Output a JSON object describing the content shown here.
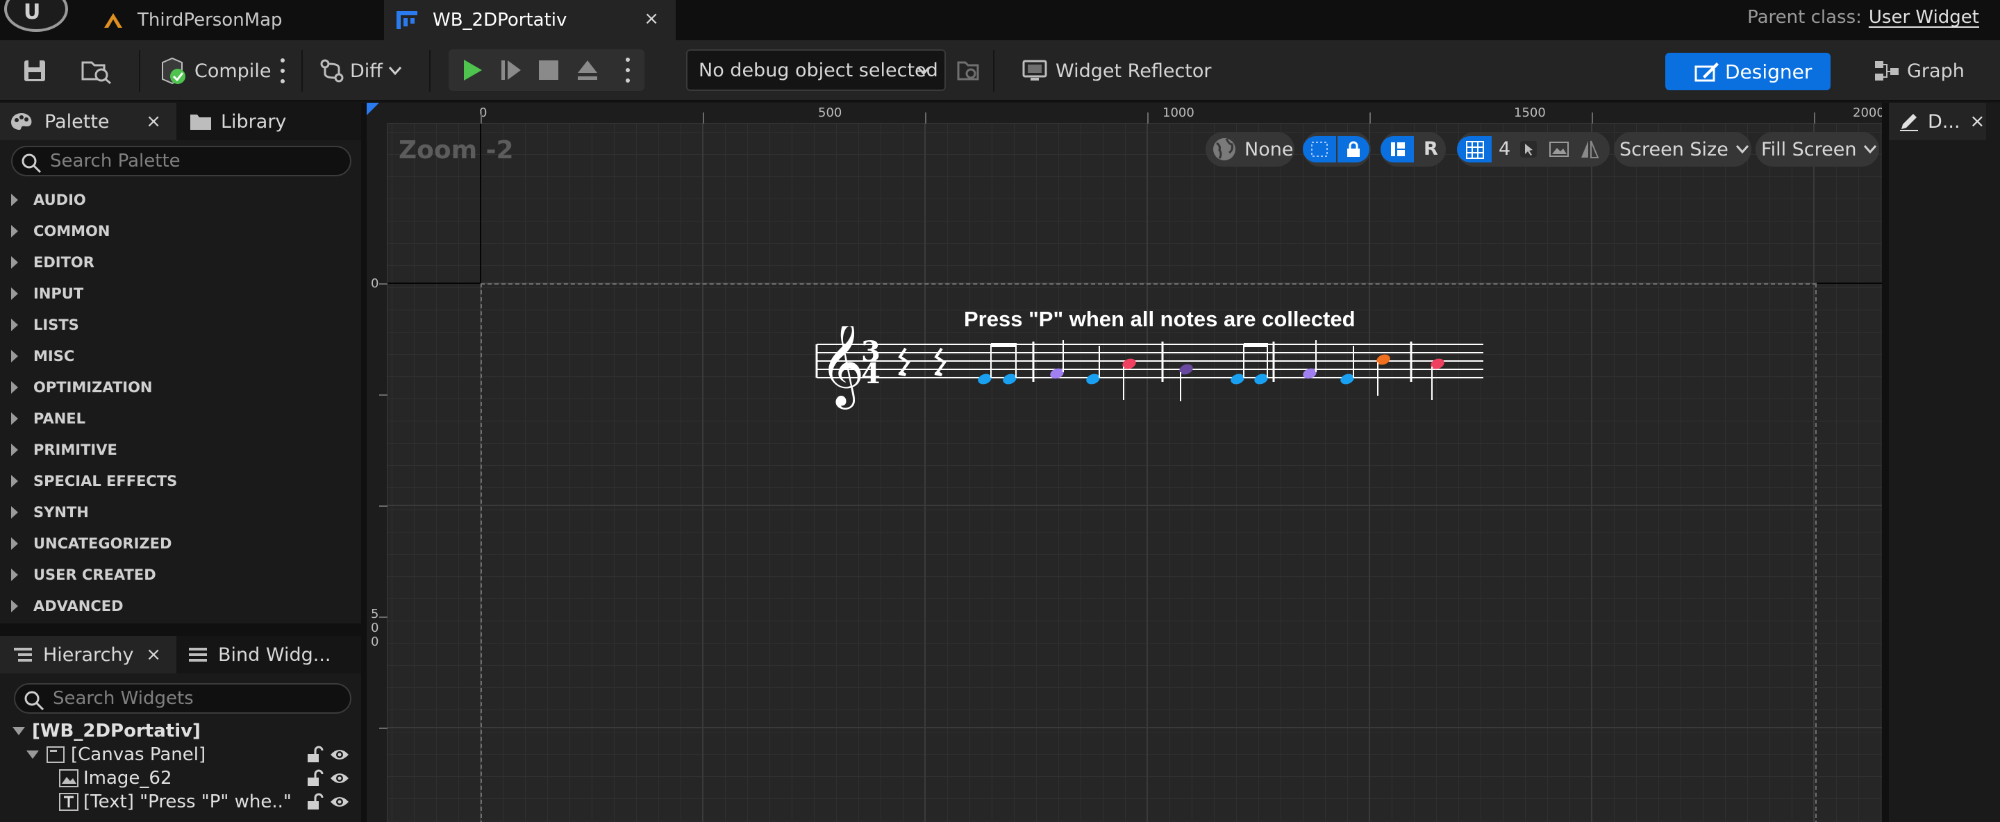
{
  "titlebar": {
    "tabs": [
      {
        "label": "ThirdPersonMap"
      },
      {
        "label": "WB_2DPortativ"
      }
    ],
    "close_glyph": "×",
    "parent_class_label": "Parent class:",
    "parent_class_value": "User Widget"
  },
  "toolbar": {
    "compile_label": "Compile",
    "diff_label": "Diff",
    "debug_select_value": "No debug object selected",
    "widget_reflector_label": "Widget Reflector",
    "designer_label": "Designer",
    "graph_label": "Graph",
    "accent_color": "#0a70e0",
    "play_color": "#4ec44e"
  },
  "palette": {
    "tab_palette": "Palette",
    "tab_library": "Library",
    "search_placeholder": "Search Palette",
    "categories": [
      "AUDIO",
      "COMMON",
      "EDITOR",
      "INPUT",
      "LISTS",
      "MISC",
      "OPTIMIZATION",
      "PANEL",
      "PRIMITIVE",
      "SPECIAL EFFECTS",
      "SYNTH",
      "UNCATEGORIZED",
      "USER CREATED",
      "ADVANCED"
    ]
  },
  "hierarchy": {
    "tab_hierarchy": "Hierarchy",
    "tab_bind": "Bind Widg...",
    "search_placeholder": "Search Widgets",
    "rows": [
      "[WB_2DPortativ]",
      "[Canvas Panel]",
      "Image_62",
      "[Text] \"Press \"P\" whe..\""
    ]
  },
  "viewport": {
    "zoom_label": "Zoom -2",
    "ruler_top": [
      "0",
      "500",
      "1000",
      "1500",
      "2000"
    ],
    "ruler_left": [
      "0",
      "5",
      "0",
      "0"
    ],
    "localization_value": "None",
    "r_label": "R",
    "grid_snap_value": "4",
    "screen_size_label": "Screen Size",
    "fill_screen_label": "Fill Screen",
    "prompt_text": "Press \"P\" when all notes are collected",
    "time_signature_top": "3",
    "time_signature_bottom": "4",
    "note_colors": {
      "blue": "#1aa0f0",
      "lavender": "#a080f0",
      "red": "#f04060",
      "purple": "#6a4aa0",
      "orange": "#f07020"
    }
  },
  "details": {
    "tab_label": "D..."
  }
}
